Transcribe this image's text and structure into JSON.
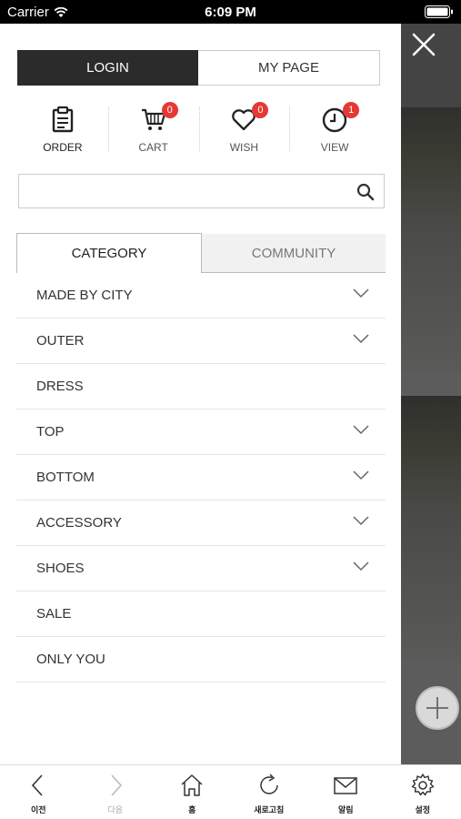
{
  "status_bar": {
    "carrier": "Carrier",
    "time": "6:09 PM"
  },
  "account_tabs": {
    "login": "LOGIN",
    "mypage": "MY PAGE"
  },
  "quick_links": [
    {
      "label": "ORDER",
      "icon": "clipboard-icon",
      "badge": null
    },
    {
      "label": "CART",
      "icon": "cart-icon",
      "badge": "0"
    },
    {
      "label": "WISH",
      "icon": "heart-icon",
      "badge": "0"
    },
    {
      "label": "VIEW",
      "icon": "clock-icon",
      "badge": "1"
    }
  ],
  "search": {
    "value": "",
    "placeholder": ""
  },
  "content_tabs": {
    "category": "CATEGORY",
    "community": "COMMUNITY",
    "active": "category"
  },
  "categories": [
    {
      "label": "MADE BY CITY",
      "expandable": true
    },
    {
      "label": "OUTER",
      "expandable": true
    },
    {
      "label": "DRESS",
      "expandable": false
    },
    {
      "label": "TOP",
      "expandable": true
    },
    {
      "label": "BOTTOM",
      "expandable": true
    },
    {
      "label": "ACCESSORY",
      "expandable": true
    },
    {
      "label": "SHOES",
      "expandable": true
    },
    {
      "label": "SALE",
      "expandable": false
    },
    {
      "label": "ONLY YOU",
      "expandable": false
    }
  ],
  "toolbar": {
    "back": "이전",
    "forward": "다음",
    "home": "홈",
    "refresh": "새로고침",
    "notifications": "알림",
    "settings": "설정"
  },
  "colors": {
    "badge": "#e53935",
    "login_bg": "#2b2b2b",
    "overlay": "#5c5c5c"
  }
}
